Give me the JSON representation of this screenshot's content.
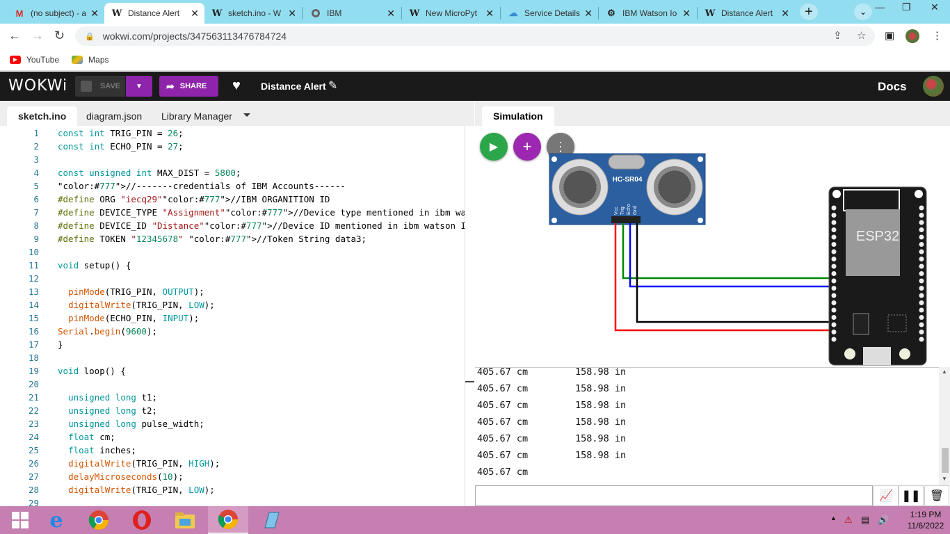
{
  "browser": {
    "tabs": [
      {
        "title": "(no subject) - a",
        "icon": "gmail-icon"
      },
      {
        "title": "Distance Alert",
        "icon": "wokwi-icon",
        "active": true
      },
      {
        "title": "sketch.ino - W",
        "icon": "wokwi-icon"
      },
      {
        "title": "IBM",
        "icon": "globe-icon"
      },
      {
        "title": "New MicroPyt",
        "icon": "wokwi-icon"
      },
      {
        "title": "Service Details",
        "icon": "cloud-icon"
      },
      {
        "title": "IBM Watson Io",
        "icon": "iot-icon"
      },
      {
        "title": "Distance Alert",
        "icon": "wokwi-icon"
      }
    ],
    "url": "wokwi.com/projects/347563113476784724",
    "bookmarks": [
      {
        "label": "YouTube",
        "color": "#ff0000"
      },
      {
        "label": "Maps",
        "color": "#34a853"
      }
    ]
  },
  "header": {
    "logo": "WOKWi",
    "save_label": "SAVE",
    "share_label": "SHARE",
    "project_title": "Distance Alert",
    "docs_label": "Docs"
  },
  "editor": {
    "tabs": [
      "sketch.ino",
      "diagram.json",
      "Library Manager"
    ],
    "lines": [
      {
        "n": "1",
        "t": "const int TRIG_PIN = 26;"
      },
      {
        "n": "2",
        "t": "const int ECHO_PIN = 27;"
      },
      {
        "n": "3",
        "t": ""
      },
      {
        "n": "4",
        "t": "const unsigned int MAX_DIST = 5800;"
      },
      {
        "n": "5",
        "t": "//-------credentials of IBM Accounts------"
      },
      {
        "n": "6",
        "t": "#define ORG \"iecq29\"//IBM ORGANITION ID"
      },
      {
        "n": "7",
        "t": "#define DEVICE_TYPE \"Assignment\"//Device type mentioned in ibm watson IOT Plat"
      },
      {
        "n": "8",
        "t": "#define DEVICE_ID \"Distance\"//Device ID mentioned in ibm watson IOT Platform"
      },
      {
        "n": "9",
        "t": "#define TOKEN \"12345678\" //Token String data3;"
      },
      {
        "n": "10",
        "t": ""
      },
      {
        "n": "11",
        "t": "void setup() {"
      },
      {
        "n": "12",
        "t": ""
      },
      {
        "n": "13",
        "t": "  pinMode(TRIG_PIN, OUTPUT);"
      },
      {
        "n": "14",
        "t": "  digitalWrite(TRIG_PIN, LOW);"
      },
      {
        "n": "15",
        "t": "  pinMode(ECHO_PIN, INPUT);"
      },
      {
        "n": "16",
        "t": "Serial.begin(9600);"
      },
      {
        "n": "17",
        "t": "}"
      },
      {
        "n": "18",
        "t": ""
      },
      {
        "n": "19",
        "t": "void loop() {"
      },
      {
        "n": "20",
        "t": ""
      },
      {
        "n": "21",
        "t": "  unsigned long t1;"
      },
      {
        "n": "22",
        "t": "  unsigned long t2;"
      },
      {
        "n": "23",
        "t": "  unsigned long pulse_width;"
      },
      {
        "n": "24",
        "t": "  float cm;"
      },
      {
        "n": "25",
        "t": "  float inches;"
      },
      {
        "n": "26",
        "t": "  digitalWrite(TRIG_PIN, HIGH);"
      },
      {
        "n": "27",
        "t": "  delayMicroseconds(10);"
      },
      {
        "n": "28",
        "t": "  digitalWrite(TRIG_PIN, LOW);"
      },
      {
        "n": "29",
        "t": ""
      }
    ]
  },
  "simulation": {
    "tab_label": "Simulation",
    "sensor_label": "HC-SR04",
    "sensor_pins": [
      "Vcc",
      "Trig",
      "Echo",
      "Gnd"
    ],
    "board_label": "ESP32",
    "wire_colors": [
      "#ff0000",
      "#008800",
      "#0000ff",
      "#000000"
    ]
  },
  "serial": {
    "rows": [
      {
        "cm": "405.67 cm",
        "in": "158.98 in"
      },
      {
        "cm": "405.67 cm",
        "in": "158.98 in"
      },
      {
        "cm": "405.67 cm",
        "in": "158.98 in"
      },
      {
        "cm": "405.67 cm",
        "in": "158.98 in"
      },
      {
        "cm": "405.67 cm",
        "in": "158.98 in"
      },
      {
        "cm": "405.67 cm",
        "in": "158.98 in"
      },
      {
        "cm": "405.67 cm",
        "in": ""
      }
    ]
  },
  "taskbar": {
    "time": "1:19 PM",
    "date": "11/6/2022"
  }
}
